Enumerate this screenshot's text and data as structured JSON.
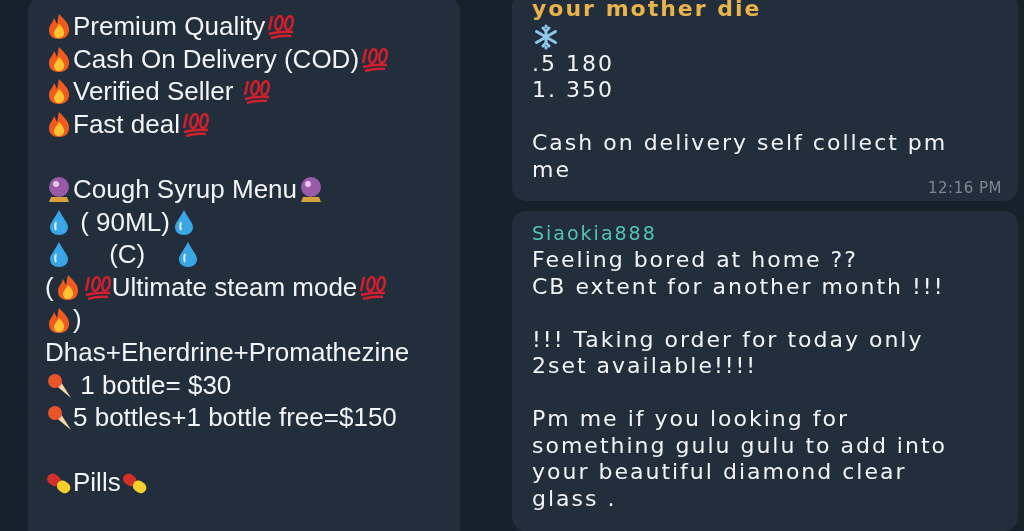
{
  "left_message": {
    "lines": [
      {
        "kind": "text",
        "parts": [
          {
            "kind": "fire"
          },
          {
            "kind": "text",
            "text": "Premium Quality"
          },
          {
            "kind": "hundred"
          }
        ]
      },
      {
        "kind": "text",
        "parts": [
          {
            "kind": "fire"
          },
          {
            "kind": "text",
            "text": "Cash On Delivery (COD)"
          },
          {
            "kind": "hundred"
          }
        ]
      },
      {
        "kind": "text",
        "parts": [
          {
            "kind": "fire"
          },
          {
            "kind": "text",
            "text": "Verified Seller "
          },
          {
            "kind": "hundred"
          }
        ]
      },
      {
        "kind": "text",
        "parts": [
          {
            "kind": "fire"
          },
          {
            "kind": "text",
            "text": "Fast deal"
          },
          {
            "kind": "hundred"
          }
        ]
      },
      {
        "kind": "blank"
      },
      {
        "kind": "text",
        "parts": [
          {
            "kind": "crystal"
          },
          {
            "kind": "text",
            "text": "Cough Syrup Menu"
          },
          {
            "kind": "crystal"
          }
        ]
      },
      {
        "kind": "text",
        "parts": [
          {
            "kind": "drop"
          },
          {
            "kind": "text",
            "text": " ( 90ML)"
          },
          {
            "kind": "drop"
          }
        ]
      },
      {
        "kind": "text",
        "parts": [
          {
            "kind": "drop"
          },
          {
            "kind": "text",
            "text": "     (C)    "
          },
          {
            "kind": "drop"
          }
        ]
      },
      {
        "kind": "text",
        "parts": [
          {
            "kind": "text",
            "text": "("
          },
          {
            "kind": "fire"
          },
          {
            "kind": "hundred"
          },
          {
            "kind": "text",
            "text": "Ultimate steam mode"
          },
          {
            "kind": "hundred"
          }
        ]
      },
      {
        "kind": "text",
        "parts": [
          {
            "kind": "fire"
          },
          {
            "kind": "text",
            "text": ")"
          }
        ]
      },
      {
        "kind": "text",
        "parts": [
          {
            "kind": "text",
            "text": "Dhas+Eherdrine+Promathezine"
          }
        ]
      },
      {
        "kind": "text",
        "parts": [
          {
            "kind": "cone"
          },
          {
            "kind": "text",
            "text": " 1 bottle= $30"
          }
        ]
      },
      {
        "kind": "text",
        "parts": [
          {
            "kind": "cone"
          },
          {
            "kind": "text",
            "text": "5 bottles+1 bottle free=$150"
          }
        ]
      },
      {
        "kind": "blank"
      },
      {
        "kind": "text",
        "parts": [
          {
            "kind": "pill"
          },
          {
            "kind": "text",
            "text": "Pills"
          },
          {
            "kind": "pill"
          }
        ]
      }
    ]
  },
  "right_messages": [
    {
      "lines": [
        {
          "kind": "quote",
          "parts": [
            {
              "kind": "text",
              "text": "your mother die"
            }
          ]
        },
        {
          "kind": "text",
          "parts": [
            {
              "kind": "snow"
            }
          ]
        },
        {
          "kind": "text",
          "parts": [
            {
              "kind": "text",
              "text": ".5 180"
            }
          ]
        },
        {
          "kind": "text",
          "parts": [
            {
              "kind": "text",
              "text": "1. 350"
            }
          ]
        },
        {
          "kind": "blank"
        },
        {
          "kind": "text",
          "parts": [
            {
              "kind": "text",
              "text": "Cash on delivery self collect pm me"
            }
          ]
        }
      ],
      "time": "12:16 PM"
    },
    {
      "sender": "Siaokia888",
      "lines": [
        {
          "kind": "text",
          "parts": [
            {
              "kind": "text",
              "text": "Feeling bored at home ??"
            }
          ]
        },
        {
          "kind": "text",
          "parts": [
            {
              "kind": "text",
              "text": "CB extent for another month !!!"
            }
          ]
        },
        {
          "kind": "blank"
        },
        {
          "kind": "text",
          "parts": [
            {
              "kind": "text",
              "text": "!!! Taking order for today only 2set available!!!!"
            }
          ]
        },
        {
          "kind": "blank"
        },
        {
          "kind": "text",
          "parts": [
            {
              "kind": "text",
              "text": "Pm me if you looking for something gulu gulu to add into your beautiful diamond clear glass ."
            }
          ]
        }
      ]
    }
  ]
}
